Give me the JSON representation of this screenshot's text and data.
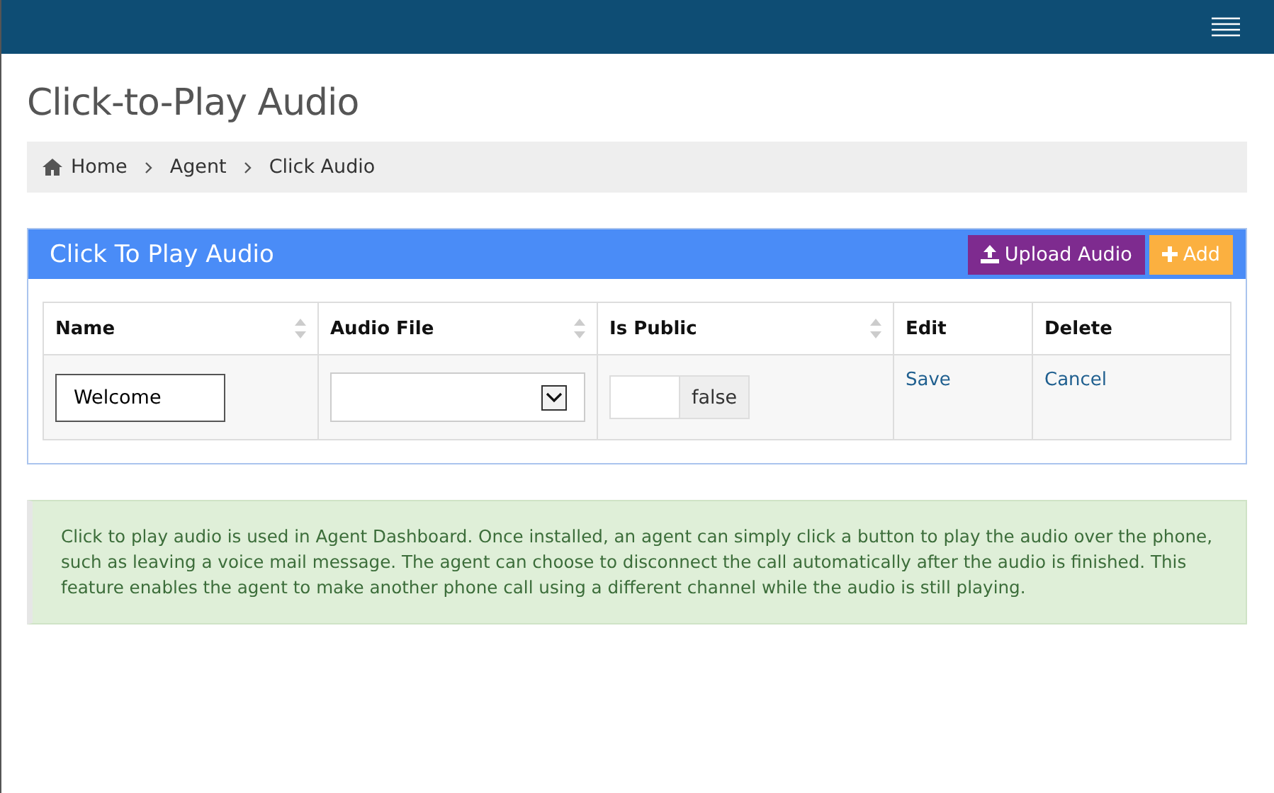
{
  "page_title": "Click-to-Play Audio",
  "breadcrumb": [
    {
      "label": "Home",
      "kind": "home"
    },
    {
      "label": "Agent",
      "kind": "link"
    },
    {
      "label": "Click Audio",
      "kind": "current"
    }
  ],
  "panel": {
    "title": "Click To Play Audio",
    "buttons": [
      {
        "label": "Upload Audio",
        "kind": "upload"
      },
      {
        "label": "Add",
        "kind": "add"
      }
    ],
    "table": {
      "columns": [
        {
          "label": "Name",
          "sortable": true
        },
        {
          "label": "Audio File",
          "sortable": true
        },
        {
          "label": "Is Public",
          "sortable": true
        },
        {
          "label": "Edit",
          "sortable": false
        },
        {
          "label": "Delete",
          "sortable": false
        }
      ],
      "rows": [
        {
          "name": {
            "value": "Welcome"
          },
          "is_public_addon": "false",
          "edit": "Save",
          "delete": "Cancel"
        }
      ]
    }
  },
  "info": "Click to play audio is used in Agent Dashboard. Once installed, an agent can simply click a button to play the audio over the phone, such as leaving a voice mail message. The agent can choose to disconnect the call automatically after the audio is finished. This feature enables the agent to make another phone call using a different channel while the audio is still playing."
}
